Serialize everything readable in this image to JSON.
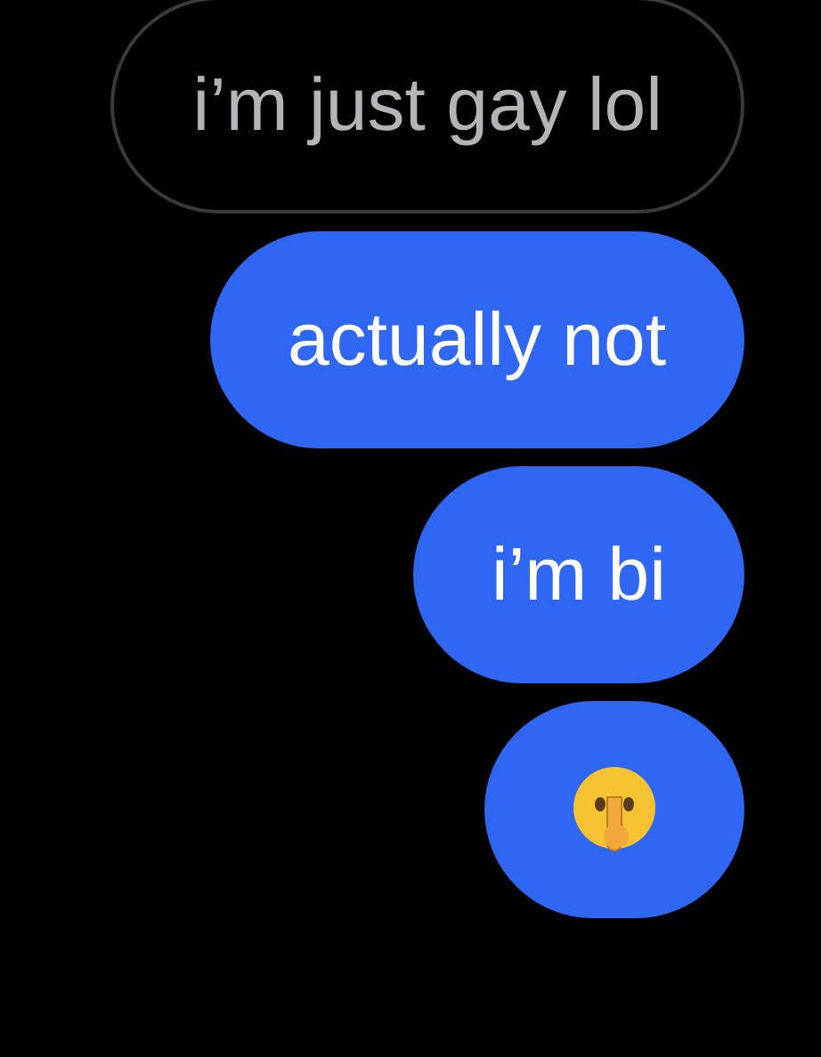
{
  "messages": [
    {
      "kind": "outline",
      "text": "i’m just gay lol"
    },
    {
      "kind": "text",
      "text": "actually not"
    },
    {
      "kind": "text",
      "text": "i’m bi"
    },
    {
      "kind": "emoji"
    }
  ]
}
